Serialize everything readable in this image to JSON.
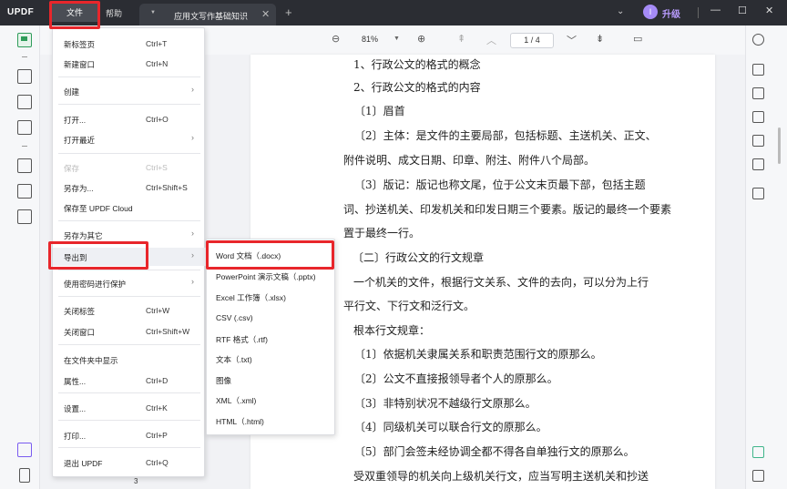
{
  "titlebar": {
    "logo": "UPDF",
    "menu_file": "文件",
    "menu_help": "帮助",
    "tab_title": "应用文写作基础知识",
    "upgrade_label": "升级",
    "avatar_initial": "I"
  },
  "toolbar": {
    "zoom": "81%",
    "page_indicator": "1 / 4"
  },
  "file_menu": {
    "items": [
      {
        "label": "新标签页",
        "shortcut": "Ctrl+T"
      },
      {
        "label": "新建窗口",
        "shortcut": "Ctrl+N"
      },
      {
        "label": "创建",
        "shortcut": ""
      },
      {
        "label": "打开...",
        "shortcut": "Ctrl+O"
      },
      {
        "label": "打开最近",
        "shortcut": ""
      },
      {
        "label": "保存",
        "shortcut": "Ctrl+S"
      },
      {
        "label": "另存为...",
        "shortcut": "Ctrl+Shift+S"
      },
      {
        "label": "保存至 UPDF Cloud",
        "shortcut": ""
      },
      {
        "label": "另存为其它",
        "shortcut": ""
      },
      {
        "label": "导出到",
        "shortcut": ""
      },
      {
        "label": "使用密码进行保护",
        "shortcut": ""
      },
      {
        "label": "关闭标签",
        "shortcut": "Ctrl+W"
      },
      {
        "label": "关闭窗口",
        "shortcut": "Ctrl+Shift+W"
      },
      {
        "label": "在文件夹中显示",
        "shortcut": ""
      },
      {
        "label": "属性...",
        "shortcut": "Ctrl+D"
      },
      {
        "label": "设置...",
        "shortcut": "Ctrl+K"
      },
      {
        "label": "打印...",
        "shortcut": "Ctrl+P"
      },
      {
        "label": "退出 UPDF",
        "shortcut": "Ctrl+Q"
      }
    ]
  },
  "export_submenu": {
    "items": [
      "Word 文档（.docx)",
      "PowerPoint 演示文稿（.pptx)",
      "Excel 工作簿（.xlsx)",
      "CSV (.csv)",
      "RTF 格式（.rtf)",
      "文本（.txt)",
      "图像",
      "XML（.xml)",
      "HTML（.html)"
    ]
  },
  "document": {
    "lines": [
      "1、行政公文的格式的概念",
      "2、行政公文的格式的内容",
      "〔1〕眉首",
      "〔2〕主体：是文件的主要局部，包括标题、主送机关、正文、",
      "附件说明、成文日期、印章、附注、附件八个局部。",
      "〔3〕版记：版记也称文尾，位于公文末页最下部，包括主题",
      "词、抄送机关、印发机关和印发日期三个要素。版记的最终一个要素",
      "置于最终一行。",
      "〔二〕行政公文的行文规章",
      "一个机关的文件，根据行文关系、文件的去向，可以分为上行",
      "平行文、下行文和泛行文。",
      "根本行文规章：",
      "〔1〕依据机关隶属关系和职责范围行文的原那么。",
      "〔2〕公文不直接报领导者个人的原那么。",
      "〔3〕非特别状况不越级行文原那么。",
      "〔4〕同级机关可以联合行文的原那么。",
      "〔5〕部门会签未经协调全都不得各自单独行文的原那么。",
      "受双重领导的机关向上级机关行文，应当写明主送机关和抄送"
    ]
  },
  "bottom_page_number": "3",
  "colors": {
    "titlebar_bg": "#2b2d33",
    "highlight_red": "#e8262b",
    "accent_green": "#2f9c5a",
    "upgrade_purple": "#b99cff"
  }
}
